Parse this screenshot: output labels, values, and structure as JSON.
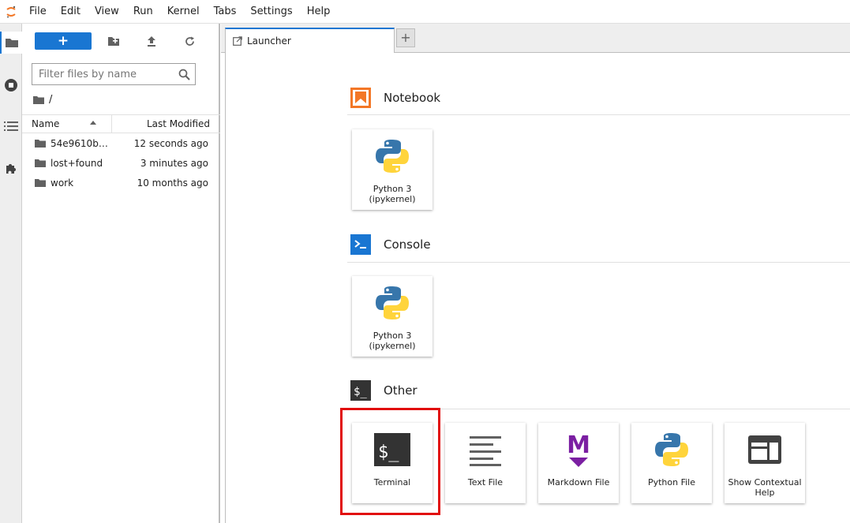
{
  "menu": [
    "File",
    "Edit",
    "View",
    "Run",
    "Kernel",
    "Tabs",
    "Settings",
    "Help"
  ],
  "file_browser": {
    "new_label": "+",
    "filter_placeholder": "Filter files by name",
    "breadcrumb": "/",
    "columns": {
      "name": "Name",
      "modified": "Last Modified"
    },
    "files": [
      {
        "name": "54e9610ba...",
        "modified": "12 seconds ago"
      },
      {
        "name": "lost+found",
        "modified": "3 minutes ago"
      },
      {
        "name": "work",
        "modified": "10 months ago"
      }
    ]
  },
  "tabs": {
    "active": "Launcher",
    "add": "+"
  },
  "launcher": {
    "sections": [
      {
        "title": "Notebook",
        "cards": [
          "Python 3\n(ipykernel)"
        ]
      },
      {
        "title": "Console",
        "cards": [
          "Python 3\n(ipykernel)"
        ]
      },
      {
        "title": "Other",
        "cards": [
          "Terminal",
          "Text File",
          "Markdown File",
          "Python File",
          "Show Contextual Help"
        ]
      }
    ],
    "console_icon_text": ">_",
    "terminal_icon_text": "$_",
    "markdown_icon_text": "M"
  },
  "colors": {
    "accent": "#1976d2",
    "notebook": "#f37726",
    "markdown": "#7b1fa2",
    "highlight": "#e10e0e"
  }
}
